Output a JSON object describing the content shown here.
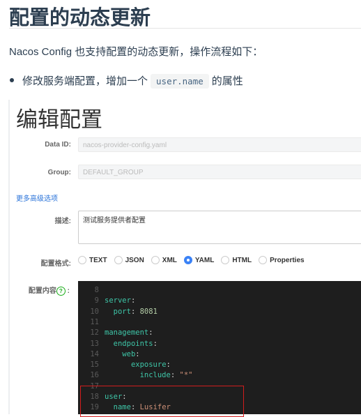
{
  "article": {
    "heading": "配置的动态更新",
    "intro": "Nacos Config 也支持配置的动态更新，操作流程如下：",
    "bullet_before": "修改服务端配置，增加一个",
    "bullet_code": "user.name",
    "bullet_after": "的属性"
  },
  "form": {
    "title": "编辑配置",
    "data_id_label": "Data ID:",
    "data_id_value": "nacos-provider-config.yaml",
    "group_label": "Group:",
    "group_value": "DEFAULT_GROUP",
    "advanced_link": "更多高级选项",
    "desc_label": "描述:",
    "desc_value": "测试服务提供者配置",
    "format_label": "配置格式:",
    "formats": [
      "TEXT",
      "JSON",
      "XML",
      "YAML",
      "HTML",
      "Properties"
    ],
    "selected_format": "YAML",
    "content_label": "配置内容",
    "content_colon": ":",
    "help_icon": "?"
  },
  "editor": {
    "lines": [
      {
        "n": "8",
        "indent": "",
        "key": "",
        "sep": "",
        "val": ""
      },
      {
        "n": "9",
        "indent": "",
        "key": "server",
        "sep": ":",
        "val": ""
      },
      {
        "n": "10",
        "indent": "  ",
        "key": "port",
        "sep": ": ",
        "val": "8081"
      },
      {
        "n": "11",
        "indent": "",
        "key": "",
        "sep": "",
        "val": ""
      },
      {
        "n": "12",
        "indent": "",
        "key": "management",
        "sep": ":",
        "val": ""
      },
      {
        "n": "13",
        "indent": "  ",
        "key": "endpoints",
        "sep": ":",
        "val": ""
      },
      {
        "n": "14",
        "indent": "    ",
        "key": "web",
        "sep": ":",
        "val": ""
      },
      {
        "n": "15",
        "indent": "      ",
        "key": "exposure",
        "sep": ":",
        "val": ""
      },
      {
        "n": "16",
        "indent": "        ",
        "key": "include",
        "sep": ": ",
        "val": "\"*\""
      },
      {
        "n": "17",
        "indent": "",
        "key": "",
        "sep": "",
        "val": ""
      },
      {
        "n": "18",
        "indent": "",
        "key": "user",
        "sep": ":",
        "val": ""
      },
      {
        "n": "19",
        "indent": "  ",
        "key": "name",
        "sep": ": ",
        "val": "Lusifer"
      }
    ]
  },
  "colors": {
    "highlight_box": "#d21d1d",
    "radio_selected": "#3b82f6",
    "link": "#2a73d9"
  }
}
